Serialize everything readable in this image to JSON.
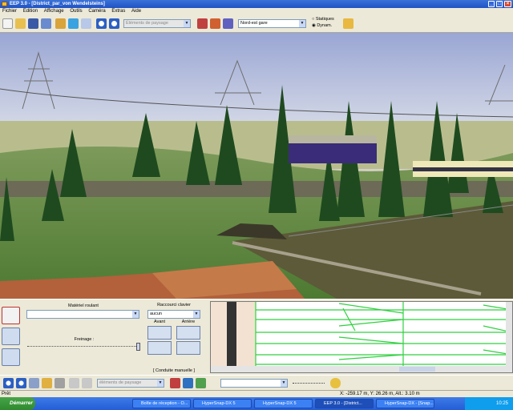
{
  "window": {
    "title": "EEP 3.0 - [District_par_von Wendelsteins]"
  },
  "menu": [
    "Fichier",
    "Edition",
    "Affichage",
    "Outils",
    "Caméra",
    "Extras",
    "Aide"
  ],
  "toolbar": {
    "landscape_combo": "Éléments de paysage",
    "camera_combo": "Nord-est gare",
    "radio_static": "Statiques",
    "radio_dynamic": "Dynam."
  },
  "control_panel": {
    "rolling_stock_label": "Matériel roulant",
    "rolling_stock_value": "",
    "shortcut_label": "Raccourci clavier",
    "shortcut_value": "aucun",
    "braking_label": "Freinage :",
    "front_label": "Avant",
    "rear_label": "Arrière",
    "manual_label": "[ Conduite manuelle ]"
  },
  "bottom_toolbar": {
    "combo1": "éléments de paysage",
    "combo2": ""
  },
  "status": {
    "left": "Prêt",
    "coords": "X: -259.17 m, Y: 26.26 m, Alt.: 3.10 m"
  },
  "taskbar": {
    "start": "Démarrer",
    "tasks": [
      "Boîte de réception - O...",
      "HyperSnap-DX 5",
      "HyperSnap-DX 5",
      "EEP 3.0 - [District...",
      "HyperSnap-DX - [Snap..."
    ],
    "clock": "10:25"
  }
}
